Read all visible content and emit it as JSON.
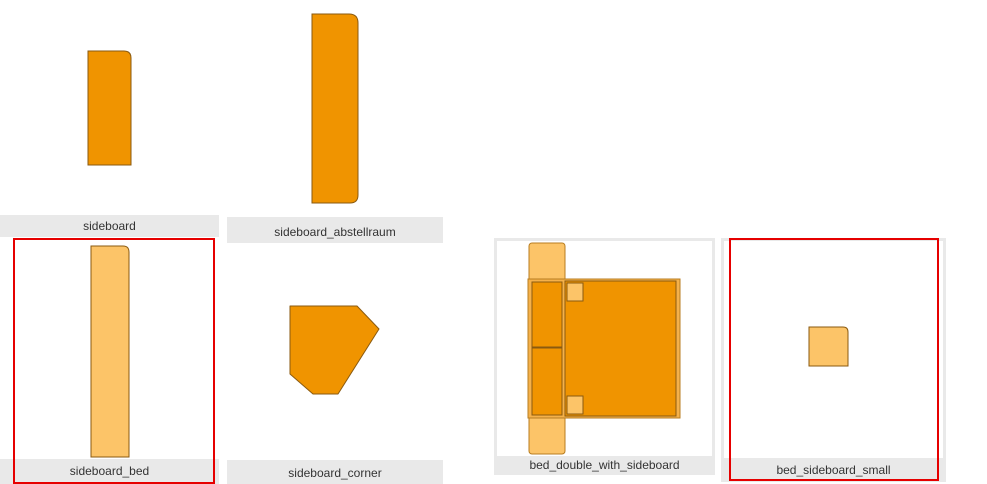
{
  "colors": {
    "primary_fill": "#f09400",
    "light_fill": "#fcc468",
    "stroke": "#8a5a10",
    "selection": "#e60000",
    "tile_bg": "#e9e9e9"
  },
  "tiles": [
    {
      "id": "sideboard",
      "label": "sideboard",
      "selected": false
    },
    {
      "id": "sideboard_abstellraum",
      "label": "sideboard_abstellraum",
      "selected": false
    },
    {
      "id": "sideboard_bed",
      "label": "sideboard_bed",
      "selected": true
    },
    {
      "id": "sideboard_corner",
      "label": "sideboard_corner",
      "selected": false
    },
    {
      "id": "bed_double_with_sideboard",
      "label": "bed_double_with_sideboard",
      "selected": false
    },
    {
      "id": "bed_sideboard_small",
      "label": "bed_sideboard_small",
      "selected": true
    }
  ]
}
